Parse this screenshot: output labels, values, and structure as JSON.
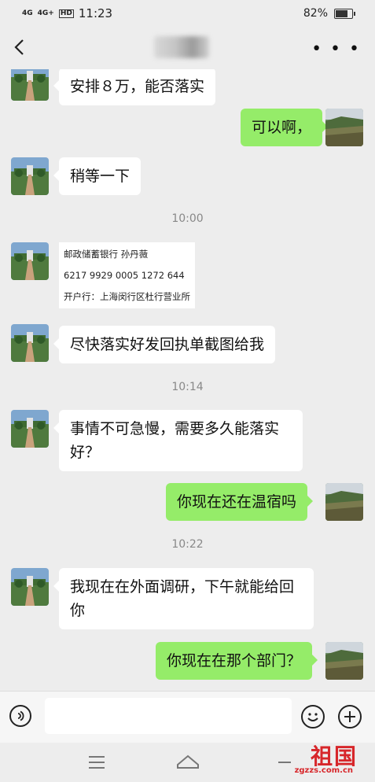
{
  "status": {
    "signal1": "4G",
    "signal2": "4G+",
    "hd": "HD",
    "time": "11:23",
    "battery": "82%",
    "battery_level": 0.82
  },
  "header": {
    "contact_name_blurred": "",
    "back_icon": "chevron-left-icon",
    "more_icon": "more-dots-icon"
  },
  "messages": [
    {
      "dir": "in",
      "text": "安排８万，能否落实"
    },
    {
      "dir": "out",
      "text": "可以啊，"
    },
    {
      "dir": "in",
      "text": "稍等一下"
    },
    {
      "dir": "time",
      "text": "10:00"
    },
    {
      "dir": "in_card",
      "lines": [
        "邮政储蓄银行  孙丹薇",
        "6217 9929 0005 1272 644",
        "开户行：上海闵行区杜行营业所"
      ]
    },
    {
      "dir": "in",
      "text": "尽快落实好发回执单截图给我"
    },
    {
      "dir": "time",
      "text": "10:14"
    },
    {
      "dir": "in",
      "text": "事情不可急慢，需要多久能落实好？"
    },
    {
      "dir": "out",
      "text": "你现在还在温宿吗"
    },
    {
      "dir": "time",
      "text": "10:22"
    },
    {
      "dir": "in",
      "text": "我现在在外面调研，下午就能给回你"
    },
    {
      "dir": "out",
      "text": "你现在在那个部门？"
    }
  ],
  "watermark": {
    "logo_text": "祖国",
    "site": "zgzzs.com.cn"
  },
  "colors": {
    "bg": "#ededed",
    "out_bubble": "#95ec69",
    "in_bubble": "#ffffff",
    "watermark": "#d7262a"
  }
}
